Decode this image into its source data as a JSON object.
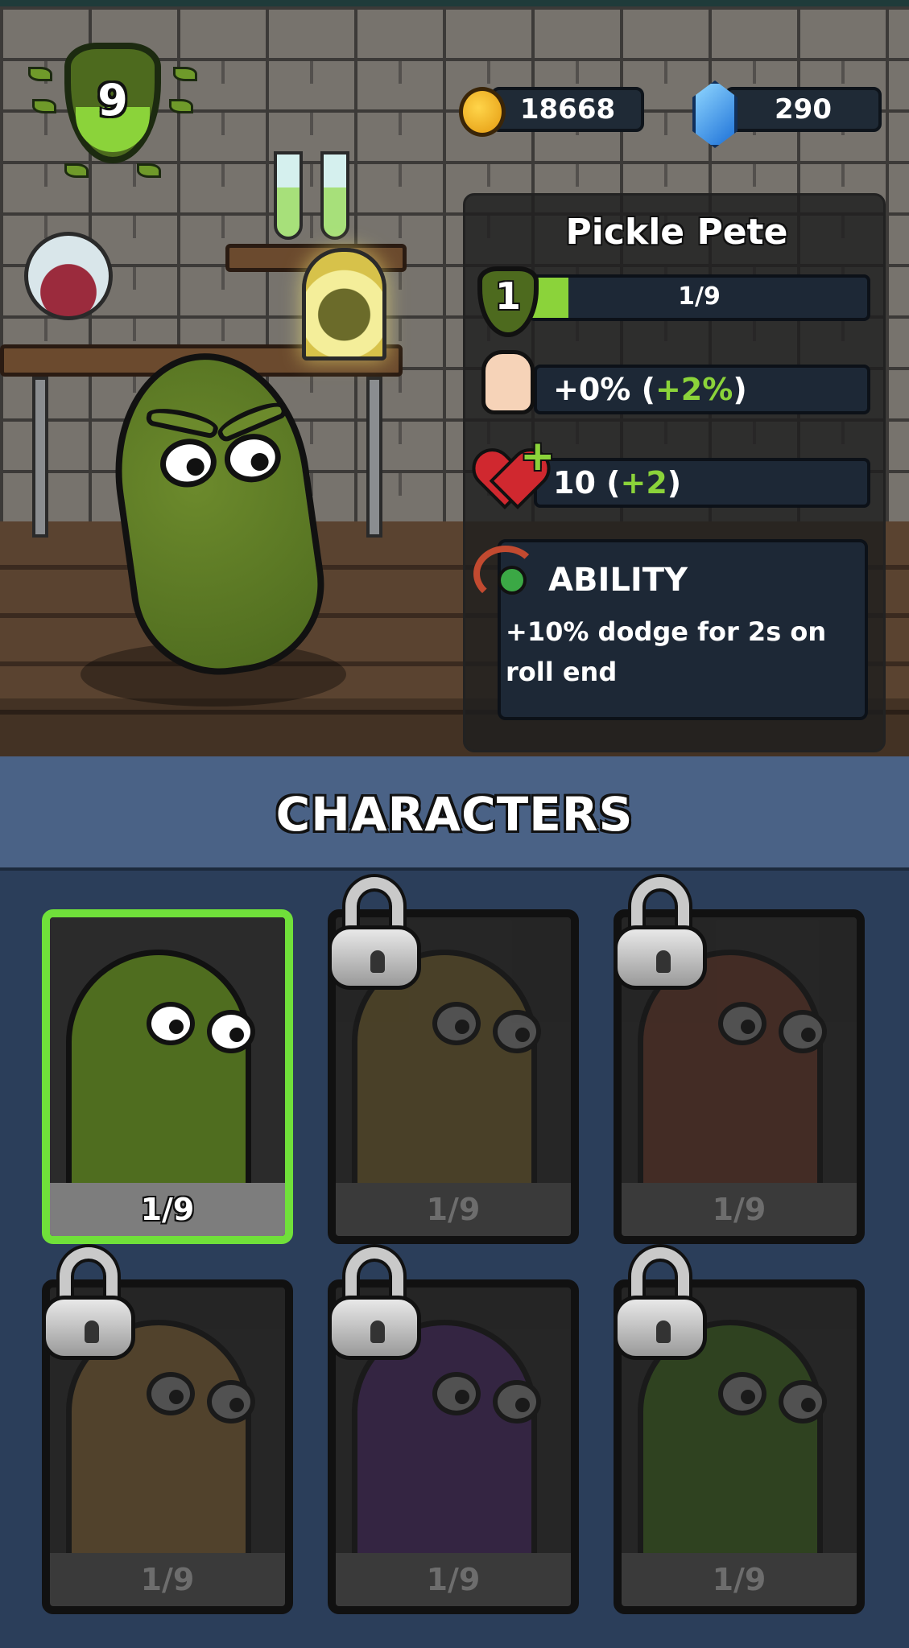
{
  "player": {
    "level": "9"
  },
  "currency": {
    "coins": "18668",
    "gems": "290"
  },
  "character": {
    "name": "Pickle Pete",
    "level": "1",
    "xp_text": "1/9",
    "xp_fraction": 0.11,
    "power_base": "+0% (",
    "power_bonus": "+2%",
    "power_close": ")",
    "health_base": "10 (",
    "health_bonus": "+2",
    "health_close": ")",
    "ability_title": "ABILITY",
    "ability_text": "+10% dodge for 2s on roll end"
  },
  "section_title": "CHARACTERS",
  "cards": [
    {
      "id": "pickle",
      "progress": "1/9",
      "locked": false,
      "selected": true,
      "color": "#4f6d1f"
    },
    {
      "id": "potato",
      "progress": "1/9",
      "locked": true,
      "selected": false,
      "color": "#7a6630"
    },
    {
      "id": "sausage",
      "progress": "1/9",
      "locked": true,
      "selected": false,
      "color": "#6b3a2a"
    },
    {
      "id": "corn",
      "progress": "1/9",
      "locked": true,
      "selected": false,
      "color": "#8a6a3a"
    },
    {
      "id": "eggplant",
      "progress": "1/9",
      "locked": true,
      "selected": false,
      "color": "#4b2a6a"
    },
    {
      "id": "pea",
      "progress": "1/9",
      "locked": true,
      "selected": false,
      "color": "#3f6a1f"
    }
  ],
  "colors": {
    "accent_green": "#8bd33a",
    "selected_border": "#70e03a",
    "panel_bg": "#1d2836",
    "header_bg": "#4a6286"
  }
}
